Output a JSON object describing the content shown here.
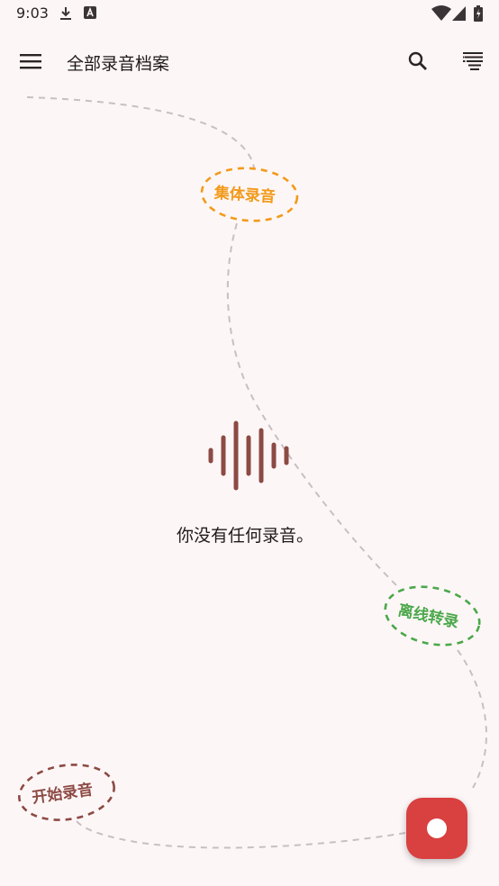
{
  "status_bar": {
    "time": "9:03",
    "icons": [
      "download-icon",
      "notification-a-icon",
      "wifi-icon",
      "signal-icon",
      "battery-charging-icon"
    ]
  },
  "app_bar": {
    "title": "全部录音档案",
    "icons": [
      "menu-icon",
      "search-icon",
      "sort-icon"
    ]
  },
  "tags": {
    "collective_recording": "集体录音",
    "offline_transcription": "离线转录",
    "start_recording": "开始录音"
  },
  "empty_state": {
    "icon": "waveform-icon",
    "message": "你没有任何录音。"
  },
  "fab": {
    "icon": "record-icon"
  },
  "colors": {
    "background": "#fdf6f6",
    "orange_tag": "#f29a1a",
    "green_tag": "#4aa84a",
    "brown_tag": "#8c4a44",
    "waveform": "#8c4a44",
    "fab": "#d94040",
    "dashed_path": "#c8bfc4"
  }
}
